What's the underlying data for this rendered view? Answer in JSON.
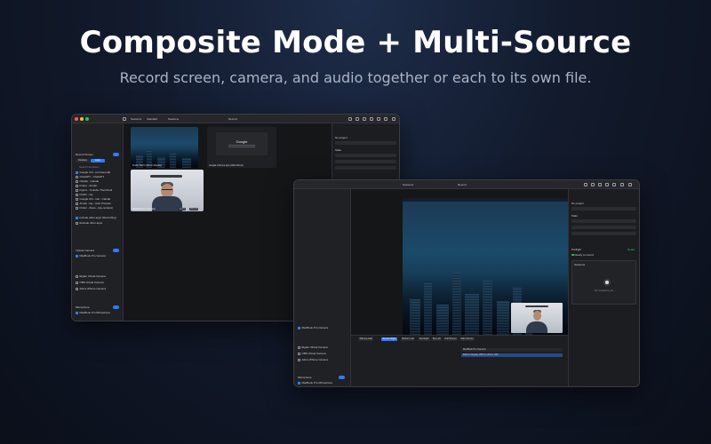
{
  "hero": {
    "title": "Composite Mode + Multi-Source",
    "subtitle": "Record screen, camera, and audio together or each to its own file."
  },
  "colors": {
    "accent": "#2f7cf6",
    "background": "#121a2c",
    "ready": "#29c46b"
  },
  "left_window": {
    "toolbar": {
      "tab_sessions": "Sessions",
      "standard": "Standard",
      "record": "Record"
    },
    "sidebar": {
      "record_screen": "Record Screen",
      "mode_options": [
        "Displays",
        "Apps"
      ],
      "search_placeholder": "Search windows...",
      "windows": [
        "Google Chr...(en-General)",
        "ChatGPT - ChatGPT",
        "Claude - Claude",
        "Finder - Finder",
        "Figma - Youtube Thumbnail",
        "Finder - lay",
        "Google Chr...ook - Claude",
        "Xcode - lay - Auto Preview",
        "Finder - Rece...(lay-renders)"
      ],
      "include_other": "Include other apps (Recording)",
      "exclude": "Exclude other apps",
      "include_camera": "Include Camera",
      "cameras": [
        "MacBook Pro Camera",
        "Elgato Virtual Camera",
        "OBS Virtual Camera",
        "Add a iPhone Camera"
      ],
      "microphone": "Microphone",
      "mics": [
        "MacBook Pro Microphone"
      ]
    },
    "tiles": [
      {
        "caption": "Finder Bell 2 (Mirror Display)",
        "btn1": "Zoom",
        "btn2": "Refresh"
      },
      {
        "caption": "Google Chrome App (Web Direct)",
        "btn1": "Zoom",
        "btn2": "Refresh",
        "page_title": "Google"
      },
      {
        "caption": "MacBook Pro Camera",
        "btn1": "Zoom",
        "btn2": "Refresh"
      }
    ],
    "right_panel": {
      "project_label": "No project",
      "state": "State",
      "preflight": "Preflight",
      "ready": "Ready",
      "ready_to_record": "Ready to record",
      "sessions": "Sessions",
      "sessions_empty": "No sessions yet"
    }
  },
  "right_window": {
    "toolbar": {
      "tab_sessions": "Sessions",
      "record": "Record"
    },
    "sidebar": {
      "cameras": [
        "MacBook Pro Camera",
        "Elgato Virtual Camera",
        "OBS Virtual Camera",
        "Add a iPhone Camera"
      ],
      "microphone": "Microphone",
      "mics": [
        "MacBook Pro Microphone"
      ]
    },
    "layout_chips": [
      "Side-by-side",
      "Screen Right",
      "Bottom Left",
      "Top Right",
      "Top Left",
      "Full Screen",
      "Side Source"
    ],
    "sources": [
      "MacBook Pro Camera",
      "Built-in Display (Mirror) (FULL HD)"
    ],
    "right_panel": {
      "project_label": "No project",
      "state": "State",
      "preflight": "Preflight",
      "ready": "Ready",
      "ready_to_record": "Ready to record",
      "sessions": "Sessions",
      "sessions_empty": "No sessions yet"
    }
  }
}
